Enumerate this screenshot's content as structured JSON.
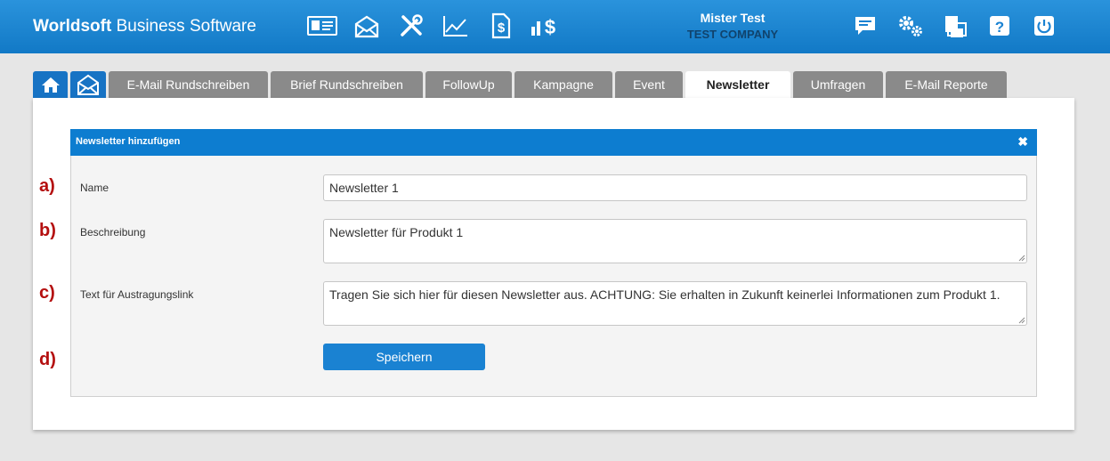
{
  "header": {
    "brand_bold": "Worldsoft",
    "brand_rest": " Business Software",
    "icons": [
      "contact-card-icon",
      "mail-settings-icon",
      "tools-icon",
      "chart-icon",
      "invoice-icon",
      "finance-icon"
    ],
    "user_name": "Mister Test",
    "company": "TEST COMPANY",
    "right_icons": [
      "messages-icon",
      "settings-icon",
      "printer-icon",
      "help-icon",
      "power-icon"
    ]
  },
  "tabs": [
    {
      "label": "E-Mail Rundschreiben"
    },
    {
      "label": "Brief Rundschreiben"
    },
    {
      "label": "FollowUp"
    },
    {
      "label": "Kampagne"
    },
    {
      "label": "Event"
    },
    {
      "label": "Newsletter",
      "active": true
    },
    {
      "label": "Umfragen"
    },
    {
      "label": "E-Mail Reporte"
    }
  ],
  "dialog": {
    "title": "Newsletter hinzufügen",
    "close_symbol": "✖",
    "markers": [
      "a)",
      "b)",
      "c)",
      "d)"
    ],
    "name_label": "Name",
    "name_value": "Newsletter 1",
    "description_label": "Beschreibung",
    "description_value": "Newsletter für Produkt 1",
    "unsubscribe_label": "Text für Austragungslink",
    "unsubscribe_value": "Tragen Sie sich hier für diesen Newsletter aus. ACHTUNG: Sie erhalten in Zukunft keinerlei Informationen zum Produkt 1.",
    "save_label": "Speichern"
  },
  "colors": {
    "header": "#1a86d4",
    "accent": "#0d7dd0",
    "tab_inactive": "#8a8a8a",
    "marker": "#b40f0f"
  }
}
